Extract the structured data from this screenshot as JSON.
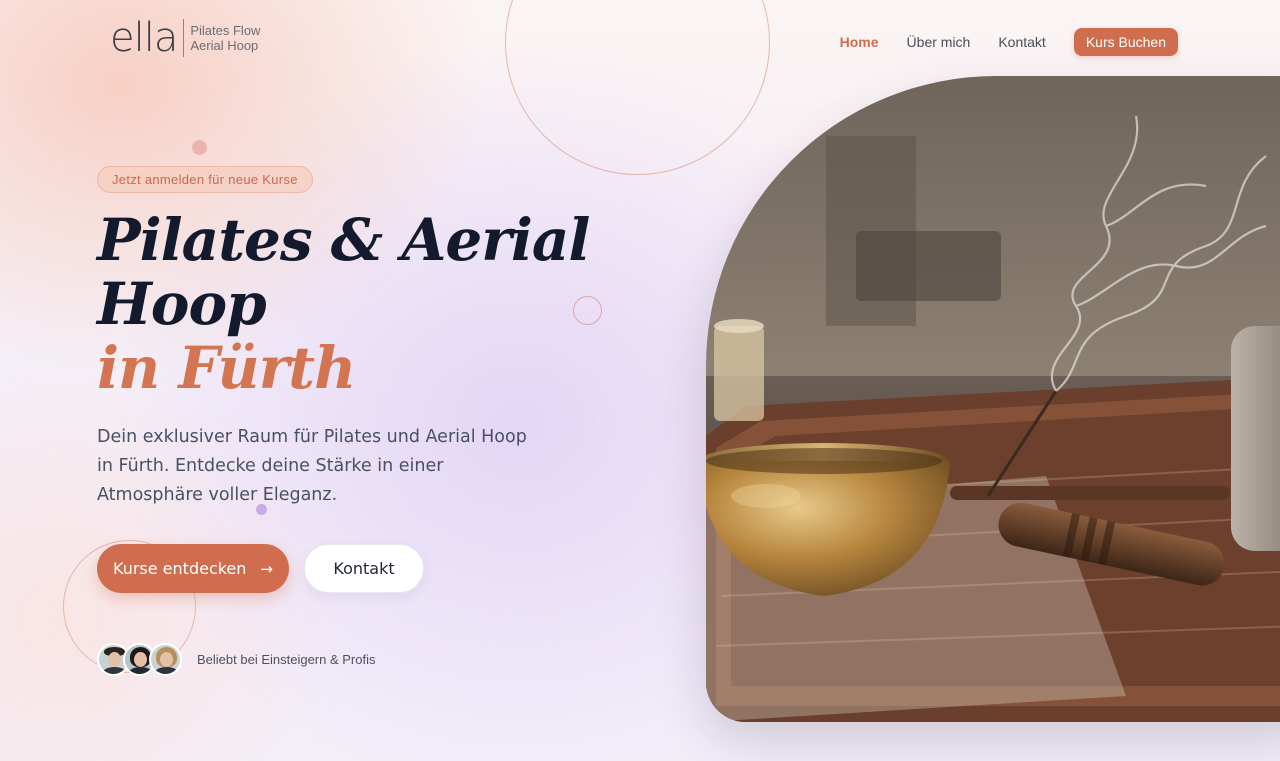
{
  "brand": {
    "name": "ella",
    "tagline_line1": "Pilates Flow",
    "tagline_line2": "Aerial Hoop"
  },
  "nav": {
    "items": [
      {
        "label": "Home",
        "active": true
      },
      {
        "label": "Über mich",
        "active": false
      },
      {
        "label": "Kontakt",
        "active": false
      }
    ],
    "cta_label": "Kurs Buchen"
  },
  "hero": {
    "badge": "Jetzt anmelden für neue Kurse",
    "title_line1": "Pilates & Aerial",
    "title_line2": "Hoop",
    "title_accent": "in Fürth",
    "lede": "Dein exklusiver Raum für Pilates und Aerial Hoop in Fürth. Entdecke deine Stärke in einer Atmosphäre voller Eleganz.",
    "primary_button": "Kurse entdecken",
    "primary_button_icon": "arrow-right-icon",
    "secondary_button": "Kontakt",
    "social_proof": "Beliebt bei Einsteigern & Profis",
    "image_subject": "singing bowl with incense on a rug"
  },
  "colors": {
    "accent": "#d06d4e",
    "title": "#141a2d",
    "text": "#4a5064"
  }
}
